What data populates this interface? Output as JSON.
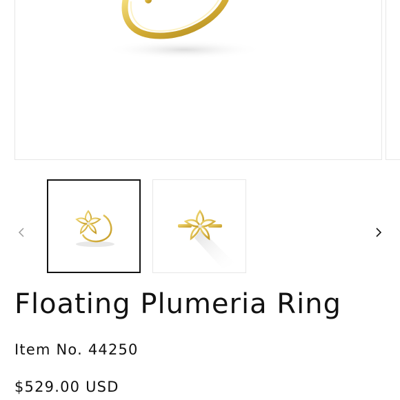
{
  "product": {
    "title": "Floating Plumeria Ring",
    "item_number": "Item No. 44250",
    "price": "$529.00 USD",
    "gold_color": "#d9b64a"
  },
  "gallery": {
    "prev_icon": "chevron-left-icon",
    "next_icon": "chevron-right-icon",
    "thumbnails": [
      {
        "name": "ring-side-view",
        "selected": true
      },
      {
        "name": "ring-top-view",
        "selected": false
      }
    ]
  }
}
